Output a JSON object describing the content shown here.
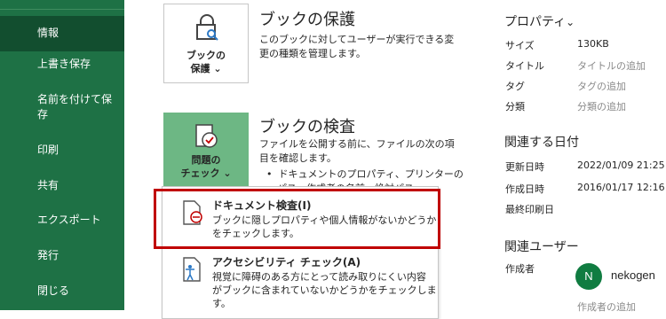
{
  "sidebar": {
    "items": [
      {
        "label": "情報",
        "active": true
      },
      {
        "label": "上書き保存"
      },
      {
        "label": "名前を付けて保存"
      },
      {
        "label": "印刷"
      },
      {
        "label": "共有"
      },
      {
        "label": "エクスポート"
      },
      {
        "label": "発行"
      },
      {
        "label": "閉じる"
      }
    ]
  },
  "protect": {
    "tile_line1": "ブックの",
    "tile_line2": "保護",
    "chevron": "⌄",
    "title": "ブックの保護",
    "desc_line1": "このブックに対してユーザーが実行できる変",
    "desc_line2": "更の種類を管理します。"
  },
  "inspect": {
    "tile_line1": "問題の",
    "tile_line2": "チェック",
    "chevron": "⌄",
    "title": "ブックの検査",
    "desc_line1": "ファイルを公開する前に、ファイルの次の項",
    "desc_line2": "目を確認します。",
    "bullet1": "ドキュメントのプロパティ、プリンターの",
    "bullet2": "パス、作成者の名前、絶対パス"
  },
  "menu": {
    "items": [
      {
        "title": "ドキュメント検査(I)",
        "desc_line1": "ブックに隠しプロパティや個人情報がないかどうか",
        "desc_line2": "をチェックします。"
      },
      {
        "title": "アクセシビリティ チェック(A)",
        "desc_line1": "視覚に障碍のある方にとって読み取りにくい内容",
        "desc_line2": "がブックに含まれていないかどうかをチェックします。"
      }
    ]
  },
  "properties": {
    "heading": "プロパティ",
    "heading_chevron": "⌄",
    "rows": [
      {
        "label": "サイズ",
        "value": "130KB"
      },
      {
        "label": "タイトル",
        "value": "タイトルの追加",
        "placeholder": true
      },
      {
        "label": "タグ",
        "value": "タグの追加",
        "placeholder": true
      },
      {
        "label": "分類",
        "value": "分類の追加",
        "placeholder": true
      }
    ]
  },
  "dates": {
    "heading": "関連する日付",
    "rows": [
      {
        "label": "更新日時",
        "value": "2022/01/09 21:25"
      },
      {
        "label": "作成日時",
        "value": "2016/01/17 12:16"
      },
      {
        "label": "最終印刷日",
        "value": ""
      }
    ]
  },
  "people": {
    "heading": "関連ユーザー",
    "author_label": "作成者",
    "avatar_initial": "N",
    "author_name": "nekogen",
    "add_author": "作成者の追加"
  },
  "colors": {
    "sidebar_bg": "#1e7145",
    "sidebar_active": "#124e2f",
    "tile_green": "#6db784",
    "highlight": "#c00000",
    "avatar_bg": "#107c41"
  }
}
